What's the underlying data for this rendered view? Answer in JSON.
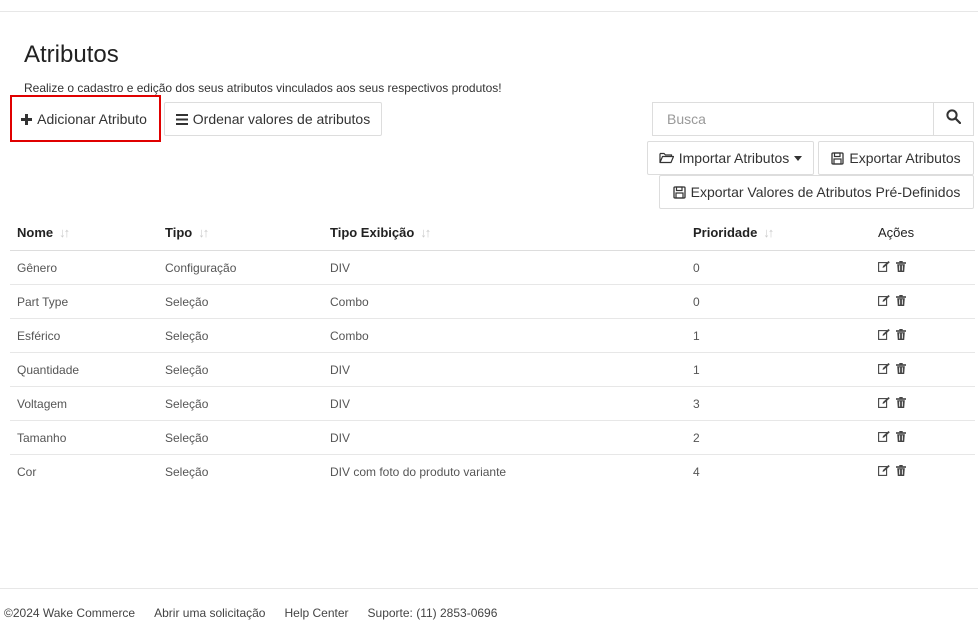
{
  "header": {
    "title": "Atributos",
    "subtitle": "Realize o cadastro e edição dos seus atributos vinculados aos seus respectivos produtos!"
  },
  "toolbar": {
    "add_label": "Adicionar Atributo",
    "order_label": "Ordenar valores de atributos",
    "import_label": "Importar Atributos",
    "export_label": "Exportar Atributos",
    "export_predefined_label": "Exportar Valores de Atributos Pré-Definidos"
  },
  "search": {
    "placeholder": "Busca",
    "value": ""
  },
  "table": {
    "columns": [
      "Nome",
      "Tipo",
      "Tipo Exibição",
      "Prioridade",
      "Ações"
    ],
    "rows": [
      [
        "Gênero",
        "Configuração",
        "DIV",
        "0"
      ],
      [
        "Part Type",
        "Seleção",
        "Combo",
        "0"
      ],
      [
        "Esférico",
        "Seleção",
        "Combo",
        "1"
      ],
      [
        "Quantidade",
        "Seleção",
        "DIV",
        "1"
      ],
      [
        "Voltagem",
        "Seleção",
        "DIV",
        "3"
      ],
      [
        "Tamanho",
        "Seleção",
        "DIV",
        "2"
      ],
      [
        "Cor",
        "Seleção",
        "DIV com foto do produto variante",
        "4"
      ]
    ],
    "row_actions": [
      "edit-icon",
      "trash-icon"
    ]
  },
  "footer": {
    "copyright": "©2024 Wake Commerce",
    "links": [
      "Abrir uma solicitação",
      "Help Center",
      "Suporte: (11) 2853-0696"
    ]
  },
  "colors": {
    "highlight": "#e00000",
    "border": "#dddddd",
    "text": "#333333"
  }
}
